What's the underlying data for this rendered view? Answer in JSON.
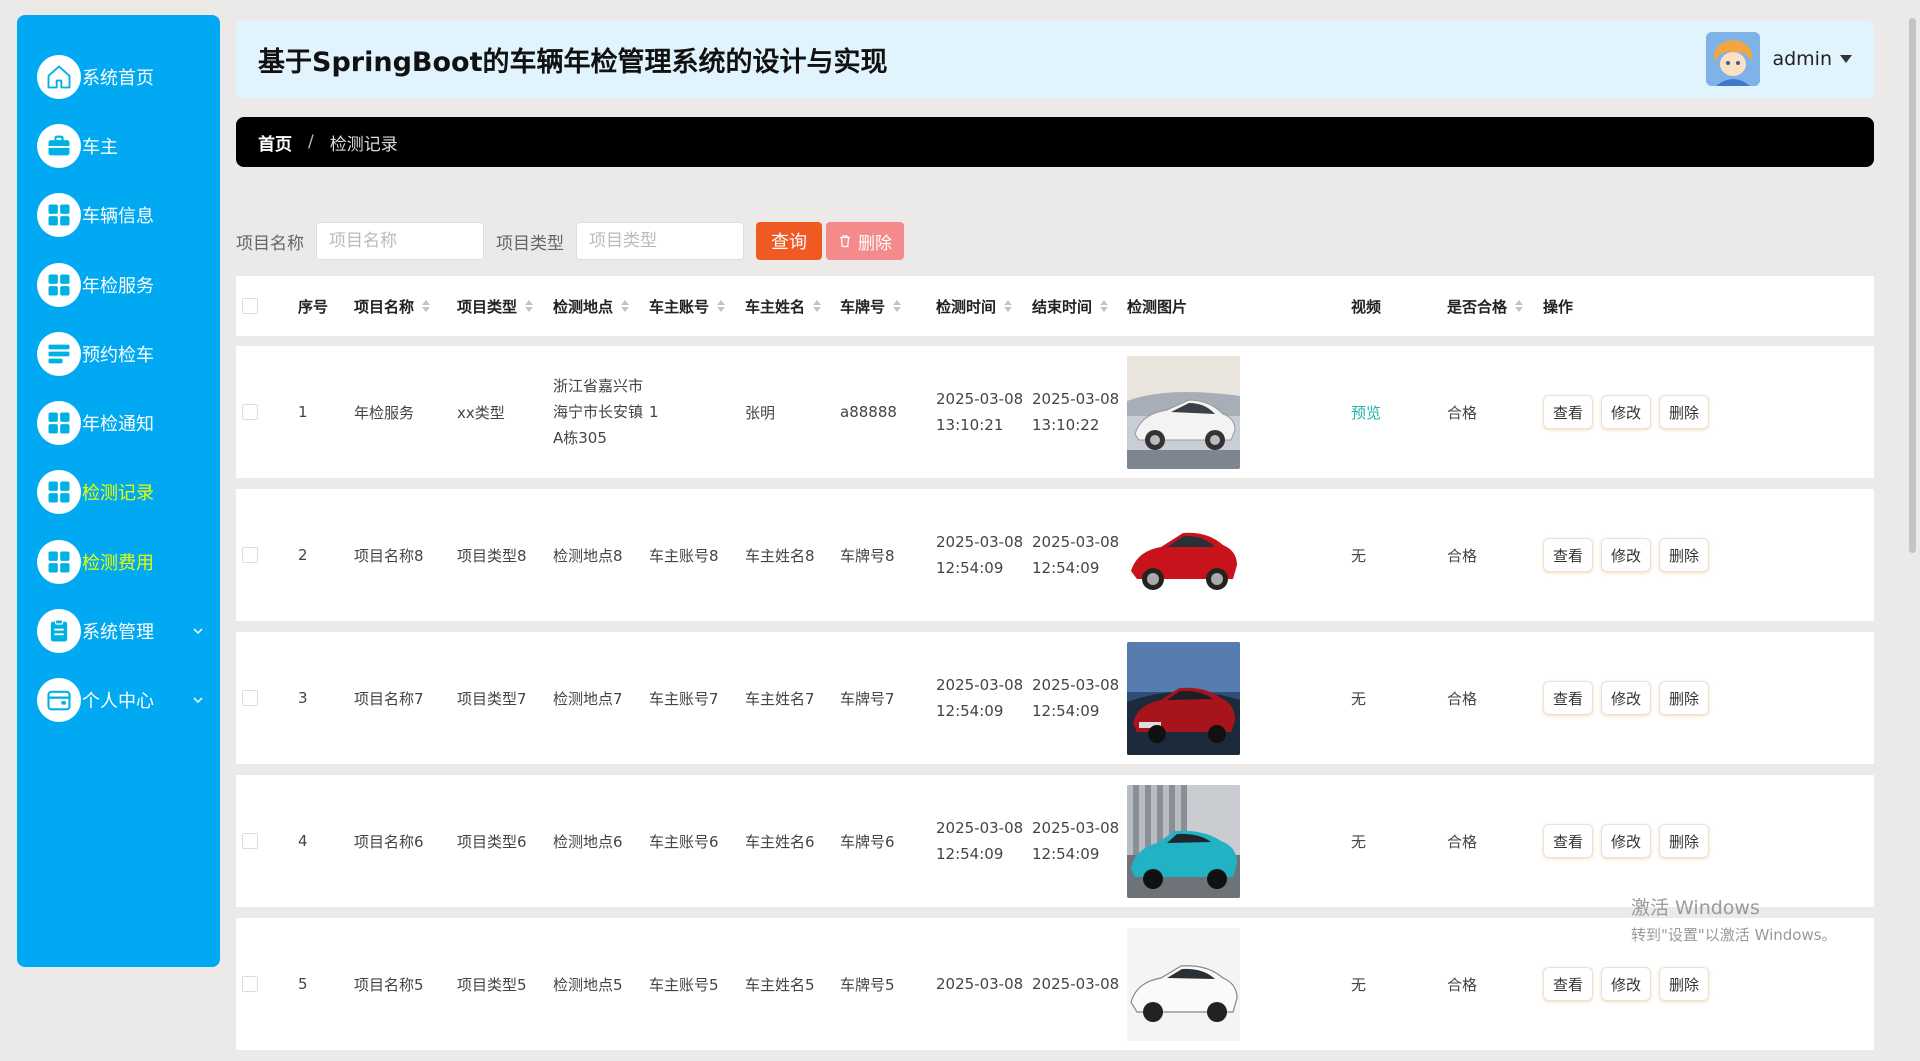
{
  "sidebar": {
    "items": [
      {
        "label": "系统首页",
        "icon": "home-icon"
      },
      {
        "label": "车主",
        "icon": "briefcase-icon"
      },
      {
        "label": "车辆信息",
        "icon": "grid-icon"
      },
      {
        "label": "年检服务",
        "icon": "grid-icon"
      },
      {
        "label": "预约检车",
        "icon": "list-icon"
      },
      {
        "label": "年检通知",
        "icon": "grid-icon"
      },
      {
        "label": "检测记录",
        "icon": "grid-icon",
        "active": true
      },
      {
        "label": "检测费用",
        "icon": "grid-icon"
      },
      {
        "label": "系统管理",
        "icon": "clipboard-icon",
        "expandable": true
      },
      {
        "label": "个人中心",
        "icon": "wallet-icon",
        "expandable": true
      }
    ],
    "bg_color": "#00a9f1",
    "active_color": "#eaff00"
  },
  "header": {
    "title": "基于SpringBoot的车辆年检管理系统的设计与实现",
    "user": "admin"
  },
  "breadcrumb": {
    "home": "首页",
    "separator": "/",
    "current": "检测记录"
  },
  "search": {
    "name_label": "项目名称",
    "name_placeholder": "项目名称",
    "type_label": "项目类型",
    "type_placeholder": "项目类型",
    "query_button": "查询",
    "delete_button": "删除"
  },
  "table": {
    "columns": {
      "index": "序号",
      "project_name": "项目名称",
      "project_type": "项目类型",
      "location": "检测地点",
      "owner_account": "车主账号",
      "owner_name": "车主姓名",
      "plate": "车牌号",
      "check_time": "检测时间",
      "end_time": "结束时间",
      "image": "检测图片",
      "video": "视频",
      "qualified": "是否合格",
      "actions": "操作"
    },
    "actions": {
      "view": "查看",
      "edit": "修改",
      "delete": "删除"
    },
    "rows": [
      {
        "index": "1",
        "project_name": "年检服务",
        "project_type": "xx类型",
        "location": "浙江省嘉兴市海宁市长安镇A栋305",
        "owner_account": "1",
        "owner_name": "张明",
        "plate": "a88888",
        "check_date": "2025-03-08",
        "check_clock": "13:10:21",
        "end_date": "2025-03-08",
        "end_clock": "13:10:22",
        "image": "white-sports-car",
        "video": "预览",
        "qualified": "合格"
      },
      {
        "index": "2",
        "project_name": "项目名称8",
        "project_type": "项目类型8",
        "location": "检测地点8",
        "owner_account": "车主账号8",
        "owner_name": "车主姓名8",
        "plate": "车牌号8",
        "check_date": "2025-03-08",
        "check_clock": "12:54:09",
        "end_date": "2025-03-08",
        "end_clock": "12:54:09",
        "image": "red-hatchback",
        "video": "无",
        "qualified": "合格"
      },
      {
        "index": "3",
        "project_name": "项目名称7",
        "project_type": "项目类型7",
        "location": "检测地点7",
        "owner_account": "车主账号7",
        "owner_name": "车主姓名7",
        "plate": "车牌号7",
        "check_date": "2025-03-08",
        "check_clock": "12:54:09",
        "end_date": "2025-03-08",
        "end_clock": "12:54:09",
        "image": "red-sedan",
        "video": "无",
        "qualified": "合格"
      },
      {
        "index": "4",
        "project_name": "项目名称6",
        "project_type": "项目类型6",
        "location": "检测地点6",
        "owner_account": "车主账号6",
        "owner_name": "车主姓名6",
        "plate": "车牌号6",
        "check_date": "2025-03-08",
        "check_clock": "12:54:09",
        "end_date": "2025-03-08",
        "end_clock": "12:54:09",
        "image": "teal-suv",
        "video": "无",
        "qualified": "合格"
      },
      {
        "index": "5",
        "project_name": "项目名称5",
        "project_type": "项目类型5",
        "location": "检测地点5",
        "owner_account": "车主账号5",
        "owner_name": "车主姓名5",
        "plate": "车牌号5",
        "check_date": "2025-03-08",
        "check_clock": "",
        "end_date": "2025-03-08",
        "end_clock": "",
        "image": "white-sedan",
        "video": "无",
        "qualified": "合格"
      }
    ]
  },
  "watermark": {
    "line1": "激活 Windows",
    "line2": "转到\"设置\"以激活 Windows。"
  }
}
